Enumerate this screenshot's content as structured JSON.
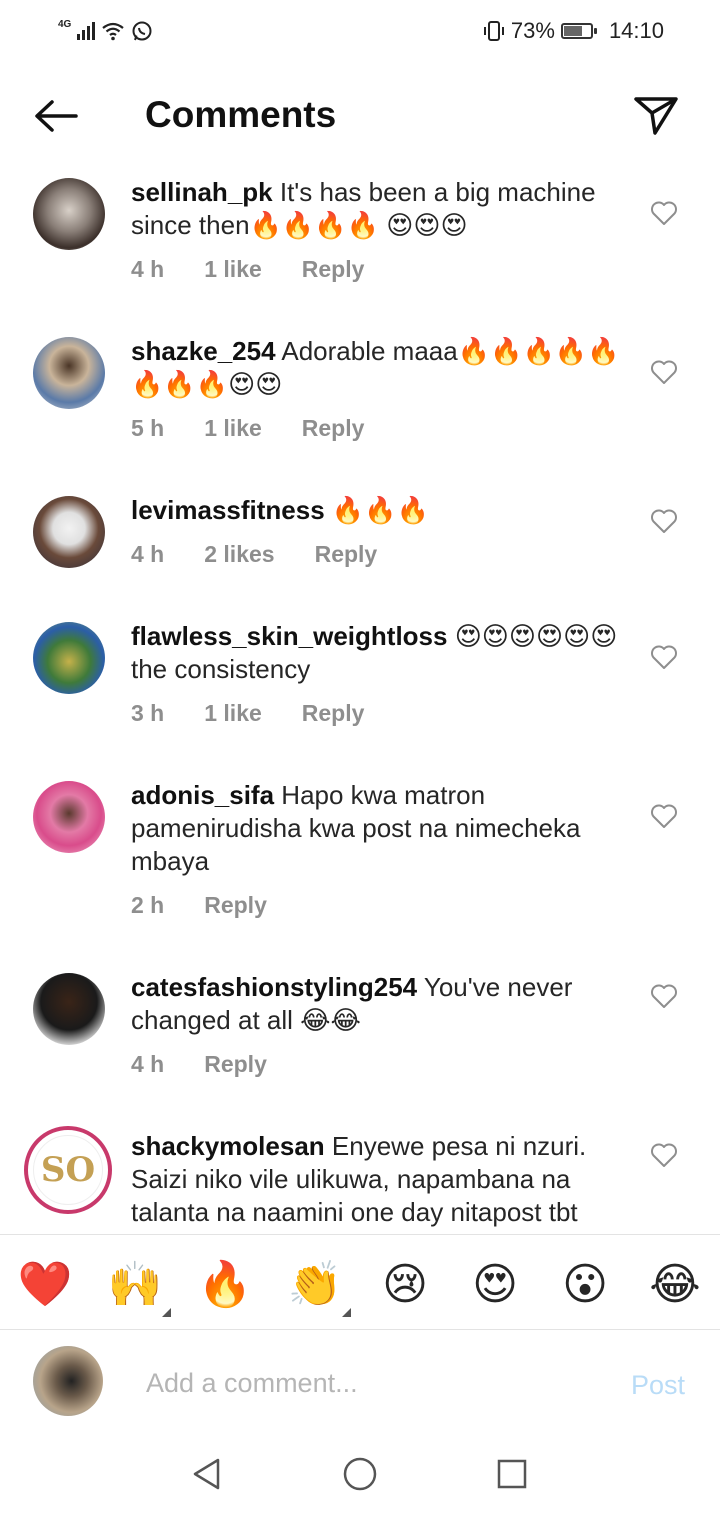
{
  "status_bar": {
    "network": "4G",
    "battery_percent": "73%",
    "battery_level": 0.73,
    "time": "14:10"
  },
  "header": {
    "title": "Comments"
  },
  "comments": [
    {
      "username": "sellinah_pk",
      "text": "It's has been a big machine since then🔥🔥🔥🔥 😍😍😍",
      "time": "4 h",
      "likes": "1 like",
      "reply": "Reply"
    },
    {
      "username": "shazke_254",
      "text": "Adorable maaa🔥🔥🔥🔥🔥🔥🔥🔥😍😍",
      "time": "5 h",
      "likes": "1 like",
      "reply": "Reply"
    },
    {
      "username": "levimassfitness",
      "text": "🔥🔥🔥",
      "time": "4 h",
      "likes": "2 likes",
      "reply": "Reply"
    },
    {
      "username": "flawless_skin_weightloss",
      "text": "😍😍😍😍😍😍the consistency",
      "time": "3 h",
      "likes": "1 like",
      "reply": "Reply"
    },
    {
      "username": "adonis_sifa",
      "text": "Hapo kwa matron pamenirudisha kwa post na nimecheka mbaya",
      "time": "2 h",
      "likes": "",
      "reply": "Reply"
    },
    {
      "username": "catesfashionstyling254",
      "text": "You've never changed at all 😂😂",
      "time": "4 h",
      "likes": "",
      "reply": "Reply"
    },
    {
      "username": "shackymolesan",
      "text": "Enyewe pesa ni nzuri. Saizi niko vile ulikuwa, napambana na talanta na naamini one day nitapost tbt",
      "time": "",
      "likes": "",
      "reply": ""
    }
  ],
  "emoji_bar": [
    "❤️",
    "🙌",
    "🔥",
    "👏",
    "😢",
    "😍",
    "😮",
    "😂"
  ],
  "input": {
    "placeholder": "Add a comment...",
    "post_label": "Post"
  },
  "colors": {
    "post_disabled": "#b9dcf7",
    "story_ring": "#c8396b",
    "meta_gray": "#8e8e8e"
  }
}
